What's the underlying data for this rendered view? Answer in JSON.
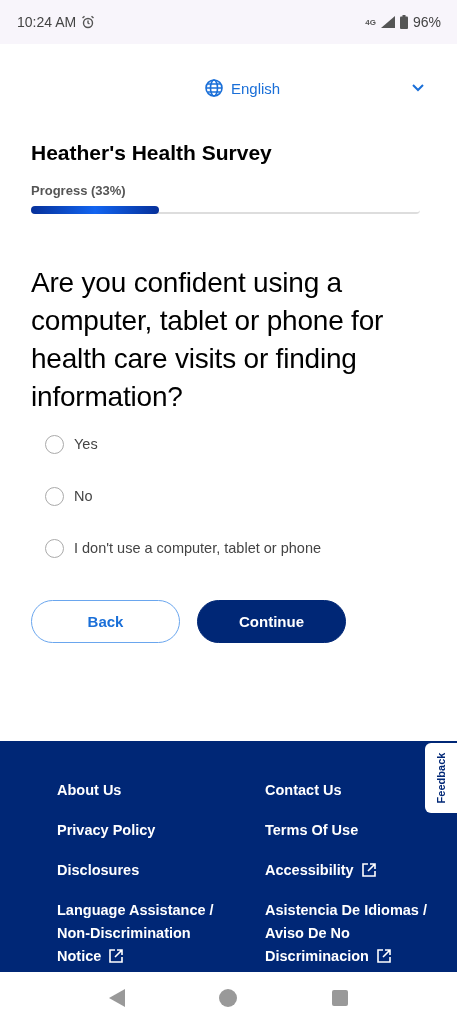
{
  "status_bar": {
    "time": "10:24 AM",
    "network": "4G",
    "battery": "96%"
  },
  "language": {
    "label": "English"
  },
  "survey": {
    "title": "Heather's Health Survey",
    "progress_label": "Progress (33%)",
    "level": 0.33
  },
  "question": "Are you confident using a computer, tablet or phone for health care visits or finding information?",
  "options": [
    {
      "label": "Yes",
      "selected": false
    },
    {
      "label": "No",
      "selected": false
    },
    {
      "label": "I don't use a computer, tablet or phone",
      "selected": false
    }
  ],
  "buttons": [
    {
      "label": "Back",
      "kind": "secondary"
    },
    {
      "label": "Continue",
      "kind": "primary"
    }
  ],
  "footer": {
    "links": [
      {
        "label": "About Us",
        "external": false
      },
      {
        "label": "Contact Us",
        "external": false
      },
      {
        "label": "Privacy Policy",
        "external": false
      },
      {
        "label": "Terms Of Use",
        "external": false
      },
      {
        "label": "Disclosures",
        "external": false
      },
      {
        "label": "Accessibility",
        "external": true
      },
      {
        "label": "Language Assistance / Non-Discrimination Notice",
        "external": true
      },
      {
        "label": "Asistencia De Idiomas / Aviso De No Discriminacion",
        "external": true
      }
    ]
  },
  "feedback_tab": "Feedback"
}
